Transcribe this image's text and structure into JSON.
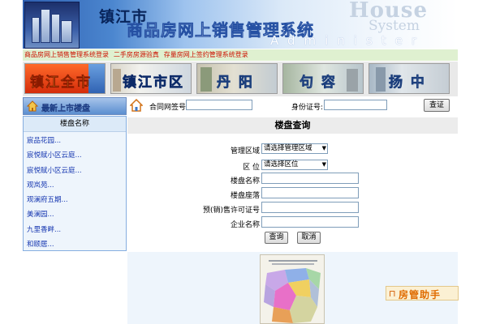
{
  "banner": {
    "city_name": "镇江市",
    "system_title": "商品房网上销售管理系统",
    "en_house": "House",
    "en_system": "System",
    "en_administer": "Administer"
  },
  "top_links": [
    {
      "label": "商品房网上销售管理系统登录"
    },
    {
      "label": "二手房房源验真"
    },
    {
      "label": "存量房网上签约管理系统登录"
    }
  ],
  "district_tabs": [
    {
      "label": "镇江全市"
    },
    {
      "label": "镇江市区"
    },
    {
      "label": "丹  阳"
    },
    {
      "label": "句  容"
    },
    {
      "label": "扬  中"
    }
  ],
  "left_panel": {
    "header": "最新上市楼盘",
    "column_header": "楼盘名称",
    "estates": [
      "宸品花园...",
      "宸悦赋小区云庭...",
      "宸悦赋小区云庭...",
      "观岚苑...",
      "观澜府五期...",
      "美澜园...",
      "九里香畔...",
      "和颐居..."
    ]
  },
  "contract_check": {
    "contract_label": "合同网签号:",
    "id_label": "身份证号:",
    "verify_button": "查证"
  },
  "query": {
    "title": "楼盘查询",
    "fields": {
      "area_label": "管理区域",
      "area_selected": "请选择管理区域",
      "district_label": "区    位",
      "district_selected": "请选择区位",
      "estate_name_label": "楼盘名称",
      "estate_location_label": "楼盘座落",
      "permit_label": "预(销)售许可证号",
      "company_label": "企业名称"
    },
    "search_button": "查询",
    "cancel_button": "取消"
  },
  "assistant": {
    "label": "房管助手"
  },
  "colors": {
    "link_red": "#cc1100",
    "link_blue": "#1536b0",
    "panel_blue": "#eef5fc",
    "accent_orange": "#e06c00"
  }
}
